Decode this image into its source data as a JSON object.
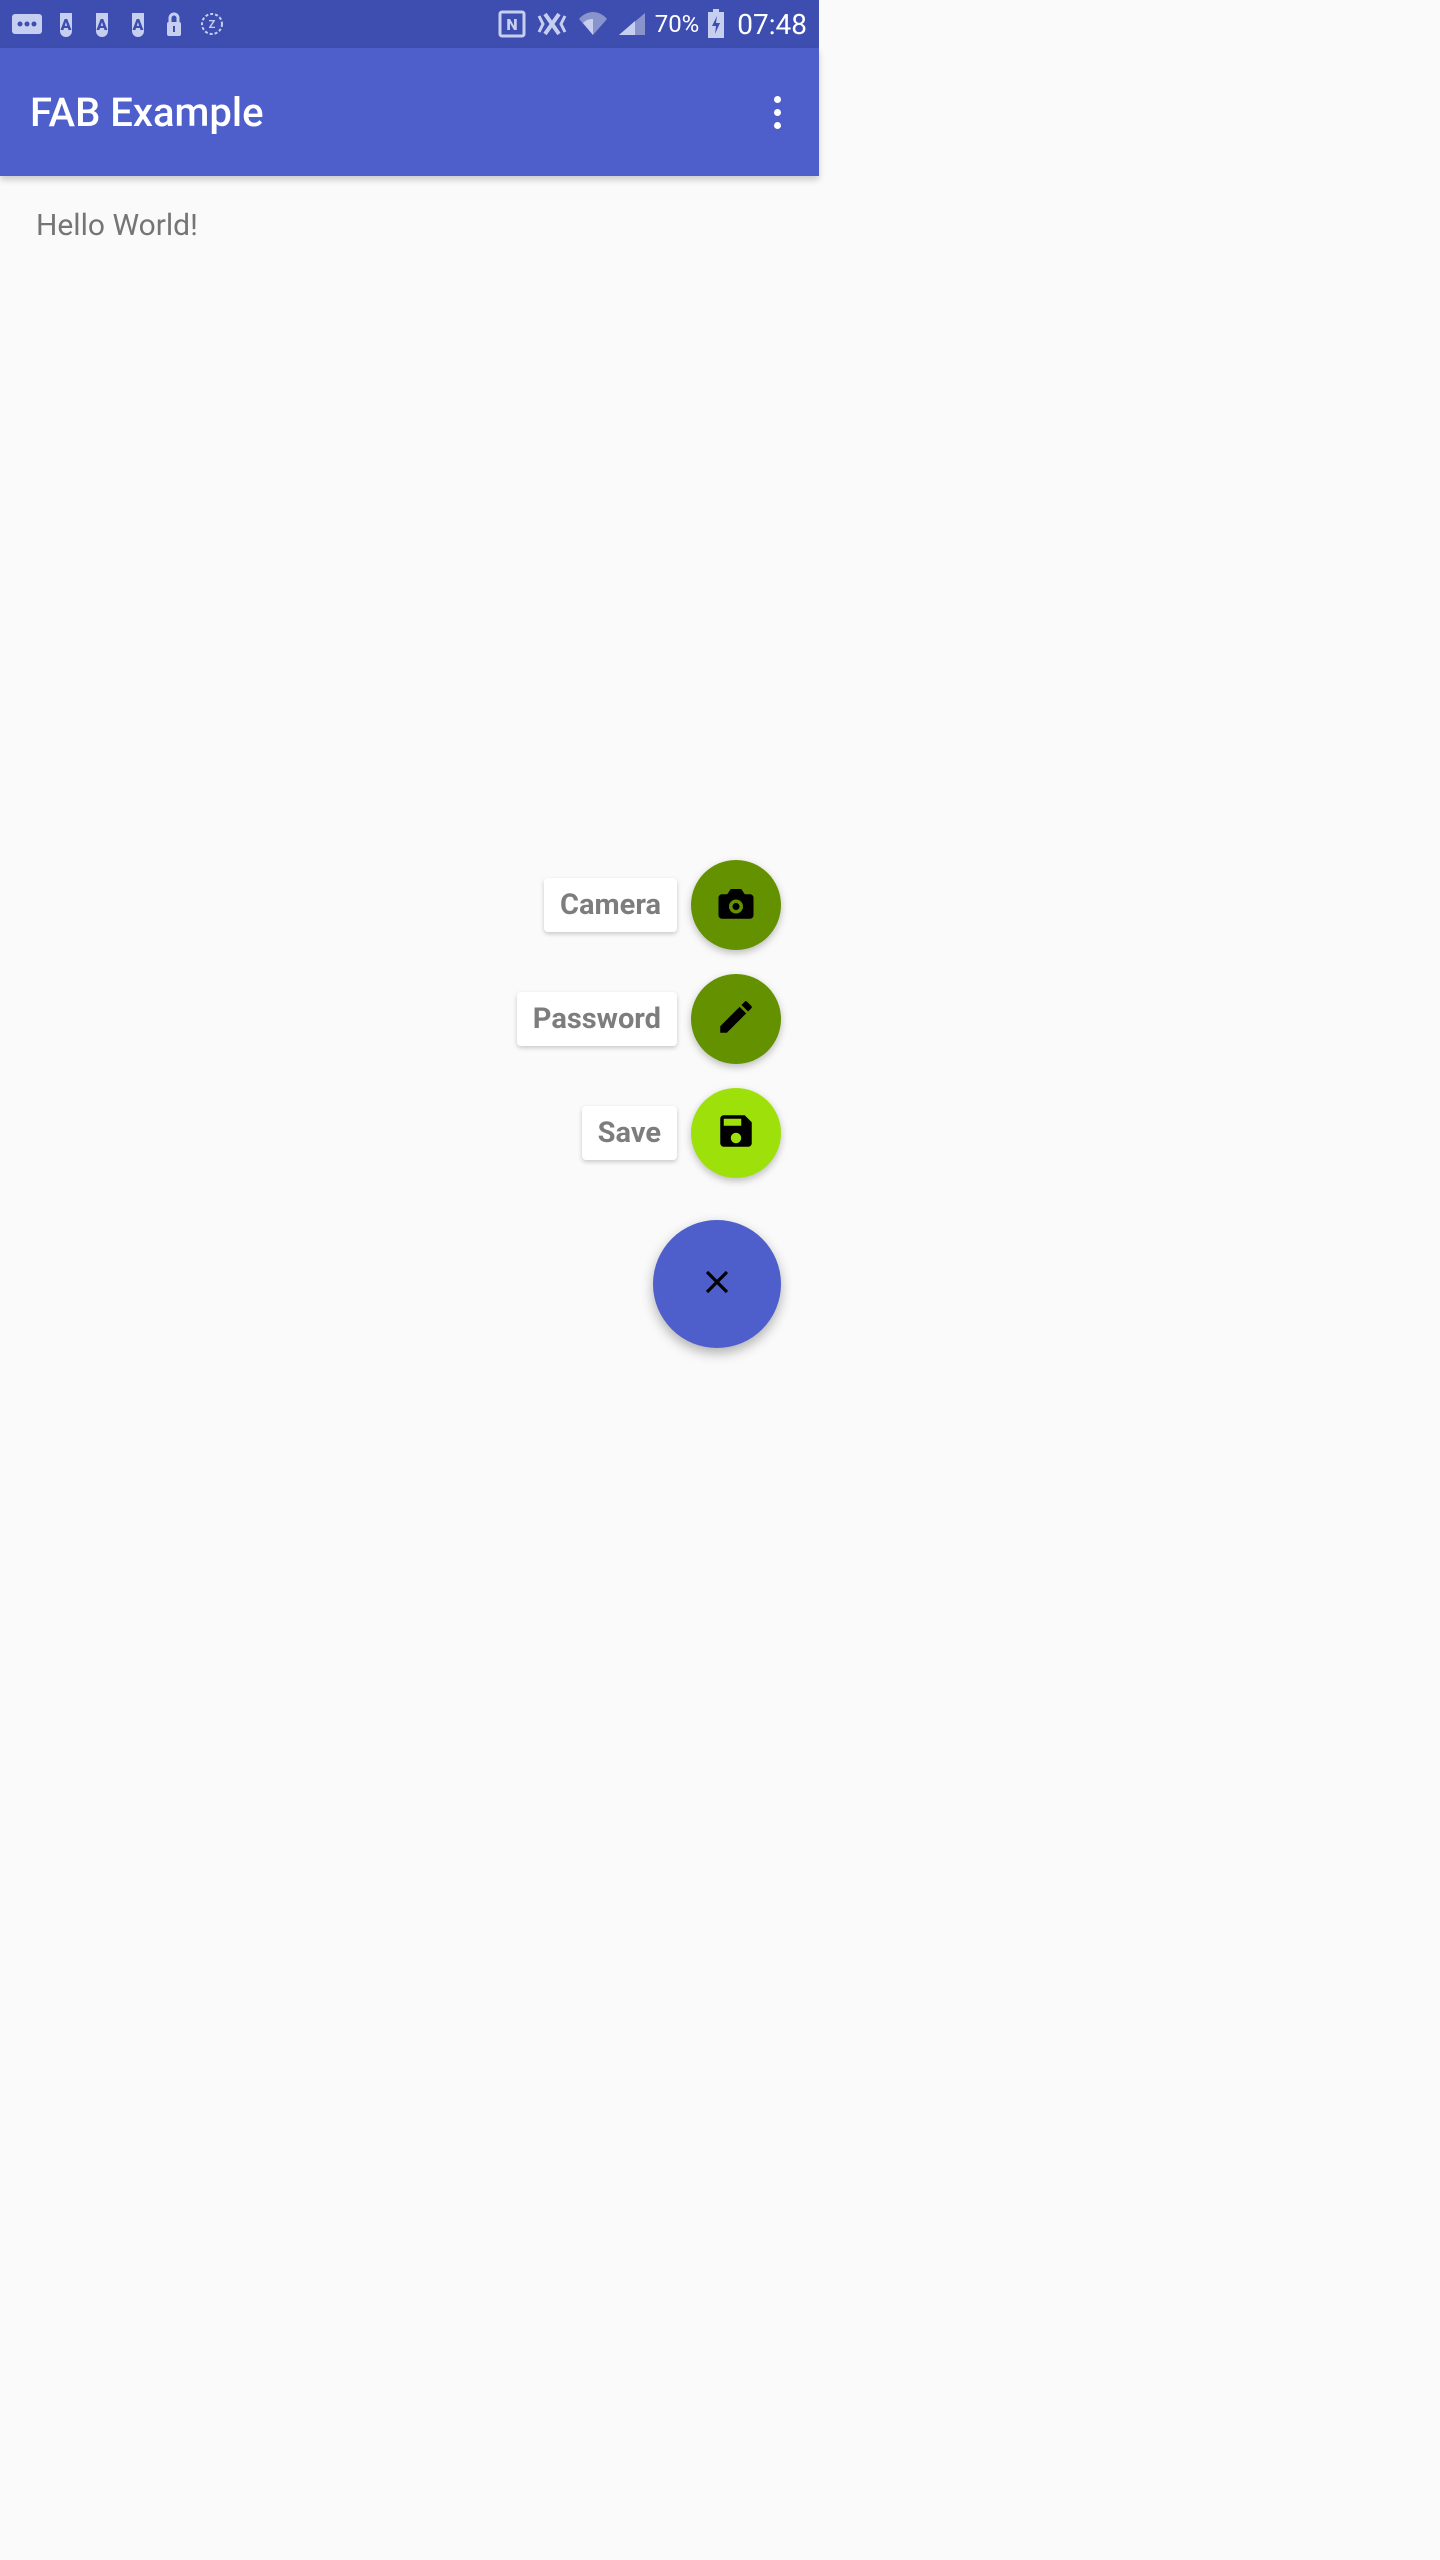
{
  "status_bar": {
    "battery_percent": "70%",
    "time": "07:48"
  },
  "app_bar": {
    "title": "FAB Example"
  },
  "main": {
    "greeting": "Hello World!"
  },
  "fab": {
    "items": [
      {
        "label": "Camera",
        "icon": "camera-icon"
      },
      {
        "label": "Password",
        "icon": "edit-icon"
      },
      {
        "label": "Save",
        "icon": "save-icon"
      }
    ],
    "main_icon": "close-icon"
  },
  "colors": {
    "primary": "#4e5ecb",
    "primary_dark": "#3e4eb0",
    "fab_dark_green": "#639100",
    "fab_light_green": "#9ee00a"
  }
}
